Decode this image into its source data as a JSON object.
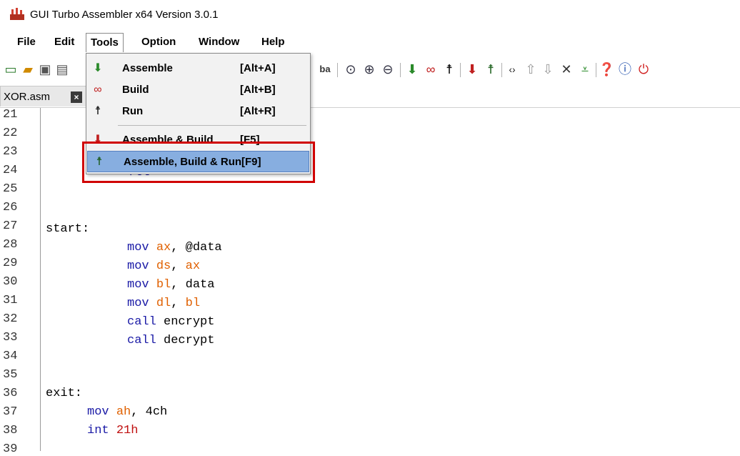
{
  "window": {
    "title": "GUI Turbo Assembler x64 Version 3.0.1"
  },
  "menubar": [
    "File",
    "Edit",
    "Tools",
    "Option",
    "Window",
    "Help"
  ],
  "tabs": [
    {
      "label": "XOR.asm"
    }
  ],
  "tools_menu": {
    "items": [
      {
        "label": "Assemble",
        "shortcut": "[Alt+A]",
        "icon": "assemble-icon"
      },
      {
        "label": "Build",
        "shortcut": "[Alt+B]",
        "icon": "build-link-icon"
      },
      {
        "label": "Run",
        "shortcut": "[Alt+R]",
        "icon": "run-icon"
      },
      {
        "label": "Assemble & Build",
        "shortcut": "[F5]",
        "icon": "assemble-build-icon"
      },
      {
        "label": "Assemble, Build & Run",
        "shortcut": "[F9]",
        "icon": "assemble-build-run-icon",
        "highlighted": true
      }
    ]
  },
  "editor": {
    "line_numbers": [
      "21",
      "22",
      "23",
      "24",
      "25",
      "26",
      "27",
      "28",
      "29",
      "30",
      "31",
      "32",
      "33",
      "34",
      "35",
      "36",
      "37",
      "38",
      "39"
    ],
    "partial_text": "ret",
    "lines": {
      "l27": "start:",
      "l28_op": "mov",
      "l28_reg": "ax",
      "l28_rest": ", @data",
      "l29_op": "mov",
      "l29_reg": "ds",
      "l29_reg2": "ax",
      "l30_op": "mov",
      "l30_reg": "bl",
      "l30_rest": ", data",
      "l31_op": "mov",
      "l31_reg": "dl",
      "l31_reg2": "bl",
      "l32_op": "call",
      "l32_rest": " encrypt",
      "l33_op": "call",
      "l33_rest": " decrypt",
      "l36": "exit:",
      "l37_op": "mov",
      "l37_reg": "ah",
      "l37_rest": ", 4ch",
      "l38_op": "int",
      "l38_num": "21h"
    }
  },
  "colors": {
    "keyword": "#1a1aa6",
    "register": "#e06000",
    "number": "#c01010",
    "highlight": "#87aee0",
    "annotation": "#d00000"
  }
}
